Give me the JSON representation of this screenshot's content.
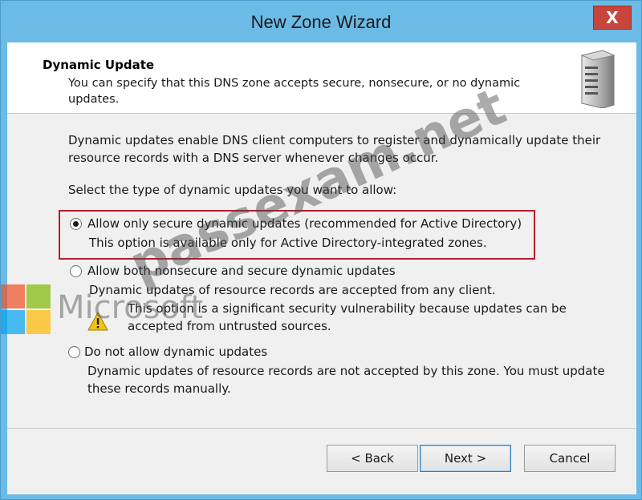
{
  "window": {
    "title": "New Zone Wizard",
    "close_label": "X"
  },
  "header": {
    "heading": "Dynamic Update",
    "subtitle": "You can specify that this DNS zone accepts secure, nonsecure, or no dynamic updates."
  },
  "main": {
    "intro": "Dynamic updates enable DNS client computers to register and dynamically update their resource records with a DNS server whenever changes occur.",
    "prompt": "Select the type of dynamic updates you want to allow:",
    "options": [
      {
        "label": "Allow only secure dynamic updates (recommended for Active Directory)",
        "description": "This option is available only for Active Directory-integrated zones.",
        "selected": true
      },
      {
        "label": "Allow both nonsecure and secure dynamic updates",
        "description": "Dynamic updates of resource records are accepted from any client.",
        "warning": "This option is a significant security vulnerability because updates can be accepted from untrusted sources.",
        "selected": false
      },
      {
        "label": "Do not allow dynamic updates",
        "description": "Dynamic updates of resource records are not accepted by this zone. You must update these records manually.",
        "selected": false
      }
    ]
  },
  "buttons": {
    "back": "< Back",
    "next": "Next >",
    "cancel": "Cancel"
  },
  "watermark": {
    "microsoft": "Microsoft",
    "site": "passexam.net"
  },
  "colors": {
    "titlebar": "#6cbae6",
    "close": "#c7463b",
    "highlight_border": "#b1212b"
  }
}
